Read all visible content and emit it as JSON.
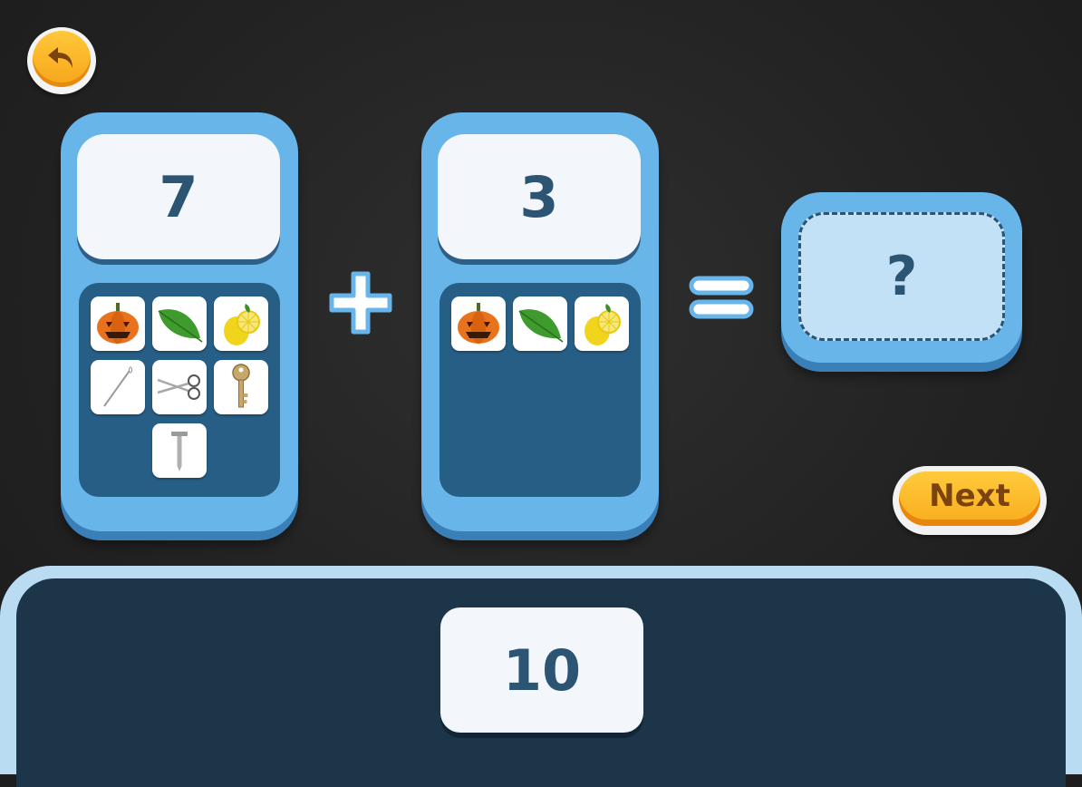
{
  "left_card": {
    "number": "7",
    "items": [
      {
        "icon": "pumpkin-icon"
      },
      {
        "icon": "leaf-icon"
      },
      {
        "icon": "lemon-icon"
      },
      {
        "icon": "needle-icon"
      },
      {
        "icon": "scissors-icon"
      },
      {
        "icon": "key-icon"
      },
      {
        "icon": "nail-icon"
      }
    ]
  },
  "operator": "plus",
  "right_card": {
    "number": "3",
    "items": [
      {
        "icon": "pumpkin-icon"
      },
      {
        "icon": "leaf-icon"
      },
      {
        "icon": "lemon-icon"
      }
    ]
  },
  "answer": {
    "placeholder": "?"
  },
  "next_button": {
    "label": "Next"
  },
  "option": {
    "value": "10"
  },
  "colors": {
    "card_blue": "#68b5ea",
    "number_text": "#2c5473",
    "button_orange": "#f9ad1d",
    "tray_dark": "#1c3548"
  }
}
